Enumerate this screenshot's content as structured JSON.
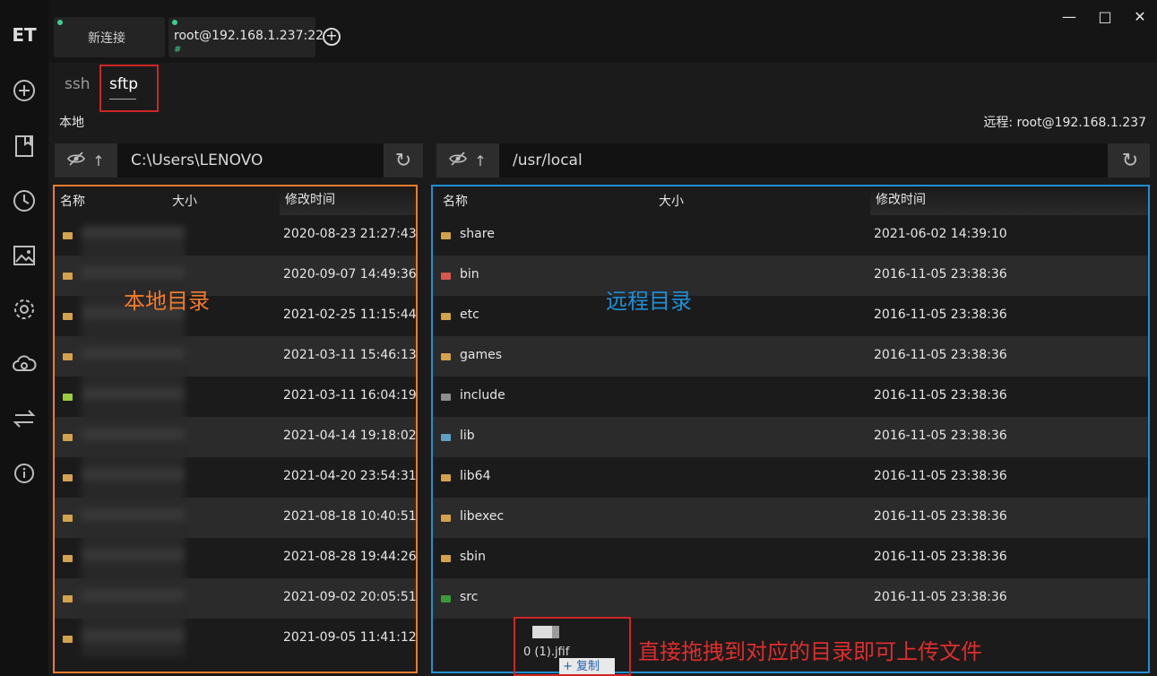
{
  "app": {
    "logo": "ET"
  },
  "rail": {
    "icons": [
      "new-connection-icon",
      "bookmark-icon",
      "history-icon",
      "image-icon",
      "gear-icon",
      "cloud-icon",
      "transfer-icon",
      "info-icon"
    ]
  },
  "tabs": [
    {
      "label": "新连接",
      "status": "connected"
    },
    {
      "label": "root@192.168.1.237:22",
      "status": "connected",
      "sub": "#"
    }
  ],
  "subtabs": {
    "ssh": "ssh",
    "sftp": "sftp",
    "active": "sftp"
  },
  "local": {
    "title": "本地",
    "path": "C:\\Users\\LENOVO",
    "columns": {
      "name": "名称",
      "size": "大小",
      "mtime": "修改时间"
    },
    "rows": [
      {
        "icon": "folder-icon",
        "mtime": "2020-08-23 21:27:43"
      },
      {
        "icon": "folder-icon",
        "mtime": "2020-09-07 14:49:36"
      },
      {
        "icon": "folder-icon",
        "mtime": "2021-02-25 11:15:44"
      },
      {
        "icon": "folder-icon",
        "mtime": "2021-03-11 15:46:13"
      },
      {
        "icon": "green-folder-icon",
        "mtime": "2021-03-11 16:04:19"
      },
      {
        "icon": "folder-icon",
        "mtime": "2021-04-14 19:18:02"
      },
      {
        "icon": "folder-icon",
        "mtime": "2021-04-20 23:54:31"
      },
      {
        "icon": "folder-icon",
        "mtime": "2021-08-18 10:40:51"
      },
      {
        "icon": "folder-icon",
        "mtime": "2021-08-28 19:44:26"
      },
      {
        "icon": "folder-icon",
        "mtime": "2021-09-02 20:05:51"
      },
      {
        "icon": "folder-icon",
        "mtime": "2021-09-05 11:41:12"
      }
    ]
  },
  "remote": {
    "title": "远程: root@192.168.1.237",
    "path": "/usr/local",
    "columns": {
      "name": "名称",
      "size": "大小",
      "mtime": "修改时间"
    },
    "rows": [
      {
        "name": "share",
        "icon": "folder-icon",
        "mtime": "2021-06-02 14:39:10"
      },
      {
        "name": "bin",
        "icon": "bin-folder-icon",
        "mtime": "2016-11-05 23:38:36"
      },
      {
        "name": "etc",
        "icon": "folder-icon",
        "mtime": "2016-11-05 23:38:36"
      },
      {
        "name": "games",
        "icon": "folder-icon",
        "mtime": "2016-11-05 23:38:36"
      },
      {
        "name": "include",
        "icon": "include-folder-icon",
        "mtime": "2016-11-05 23:38:36"
      },
      {
        "name": "lib",
        "icon": "lib-folder-icon",
        "mtime": "2016-11-05 23:38:36"
      },
      {
        "name": "lib64",
        "icon": "folder-icon",
        "mtime": "2016-11-05 23:38:36"
      },
      {
        "name": "libexec",
        "icon": "folder-icon",
        "mtime": "2016-11-05 23:38:36"
      },
      {
        "name": "sbin",
        "icon": "folder-icon",
        "mtime": "2016-11-05 23:38:36"
      },
      {
        "name": "src",
        "icon": "src-folder-icon",
        "mtime": "2016-11-05 23:38:36"
      }
    ]
  },
  "annotations": {
    "local": "本地目录",
    "remote": "远程目录",
    "drag": "直接拖拽到对应的目录即可上传文件"
  },
  "drag": {
    "filename": "0 (1).jfif",
    "action": "复制"
  },
  "colors": {
    "local_border": "#f07b2c",
    "remote_border": "#1f8fd6",
    "highlight": "#d02626",
    "status_dot": "#3ecf8e",
    "folder": "#d4a24c"
  }
}
